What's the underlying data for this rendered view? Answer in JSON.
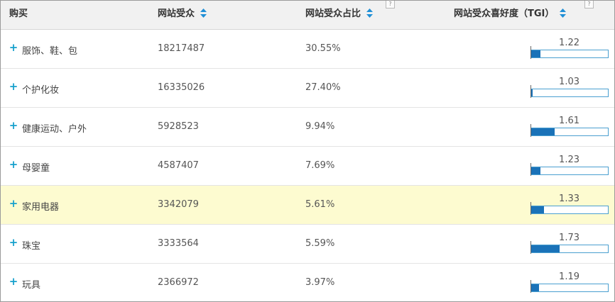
{
  "header": {
    "col1": "购买",
    "col2": "网站受众",
    "col3": "网站受众占比",
    "col4": "网站受众喜好度（TGI）",
    "help_glyph": "?"
  },
  "rows": [
    {
      "category": "服饰、鞋、包",
      "audience": "18217487",
      "share": "30.55%",
      "tgi": "1.22",
      "tgi_level": 0.12
    },
    {
      "category": "个护化妆",
      "audience": "16335026",
      "share": "27.40%",
      "tgi": "1.03",
      "tgi_level": 0.02
    },
    {
      "category": "健康运动、户外",
      "audience": "5928523",
      "share": "9.94%",
      "tgi": "1.61",
      "tgi_level": 0.31
    },
    {
      "category": "母婴童",
      "audience": "4587407",
      "share": "7.69%",
      "tgi": "1.23",
      "tgi_level": 0.12
    },
    {
      "category": "家用电器",
      "audience": "3342079",
      "share": "5.61%",
      "tgi": "1.33",
      "tgi_level": 0.17,
      "highlighted": true
    },
    {
      "category": "珠宝",
      "audience": "3333564",
      "share": "5.59%",
      "tgi": "1.73",
      "tgi_level": 0.37
    },
    {
      "category": "玩具",
      "audience": "2366972",
      "share": "3.97%",
      "tgi": "1.19",
      "tgi_level": 0.1
    }
  ],
  "icons": {
    "expand": "+",
    "sort": "sort-icon"
  },
  "colors": {
    "header_bg": "#f1f1f1",
    "highlight_row": "#fdfbd0",
    "plus": "#16a0cc",
    "bar_fill": "#1a72b8",
    "bar_border": "#4a9fd0",
    "sort_up": "#1f8fd6",
    "sort_down": "#1f8fd6"
  }
}
